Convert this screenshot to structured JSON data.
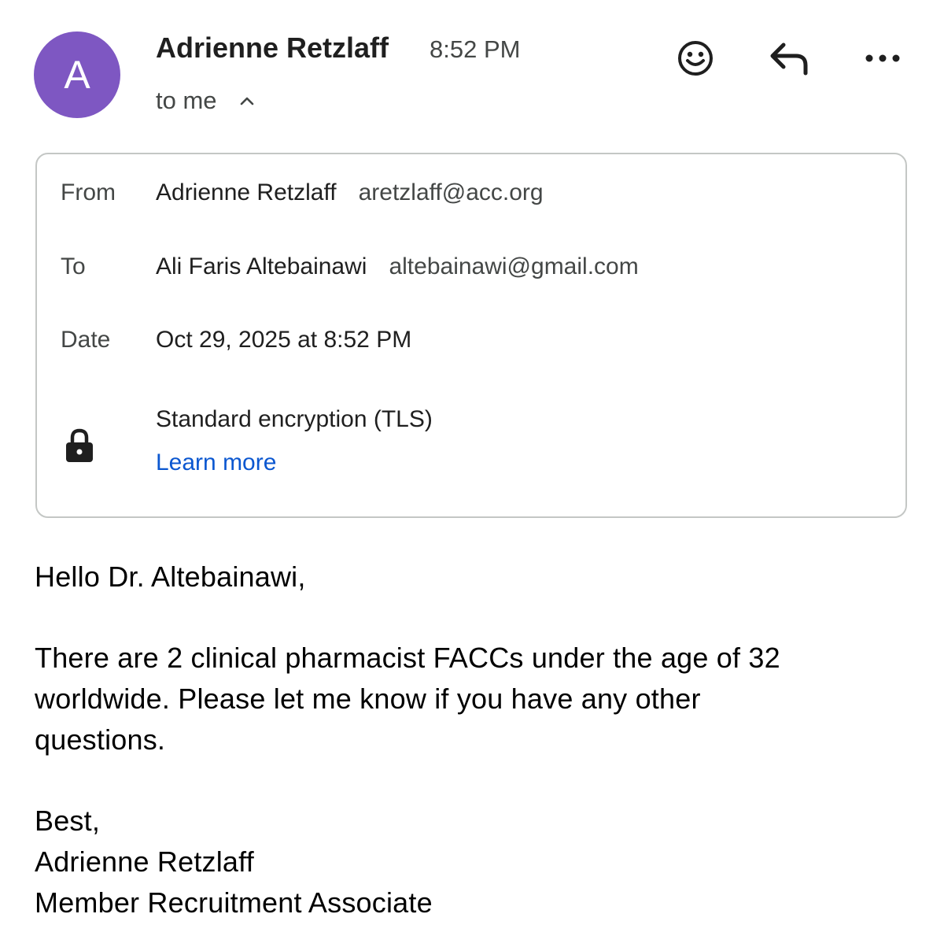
{
  "header": {
    "avatar_letter": "A",
    "avatar_color": "#7e57c2",
    "sender_name": "Adrienne Retzlaff",
    "time": "8:52 PM",
    "recipient_label": "to me",
    "actions": {
      "emoji_icon": "emoji-reaction-icon",
      "reply_icon": "reply-icon",
      "more_icon": "more-options-icon"
    }
  },
  "details": {
    "from_label": "From",
    "from_name": "Adrienne Retzlaff",
    "from_email": "aretzlaff@acc.org",
    "to_label": "To",
    "to_name": "Ali Faris Altebainawi",
    "to_email": "altebainawi@gmail.com",
    "date_label": "Date",
    "date_value": "Oct 29, 2025 at 8:52 PM",
    "security_icon": "lock-icon",
    "security_text": "Standard encryption (TLS)",
    "learn_more": "Learn more"
  },
  "message": {
    "greeting": "Hello Dr. Altebainawi,",
    "paragraph_lines": [
      "There are 2 clinical pharmacist FACCs under the age of 32",
      "worldwide. Please let me know if you have any other",
      "questions."
    ],
    "signoff": "Best,",
    "signature_name": "Adrienne Retzlaff",
    "signature_title": "Member Recruitment Associate"
  },
  "colors": {
    "link": "#0b57d0",
    "secondary_text": "#444746",
    "card_border": "#c4c7c5"
  }
}
